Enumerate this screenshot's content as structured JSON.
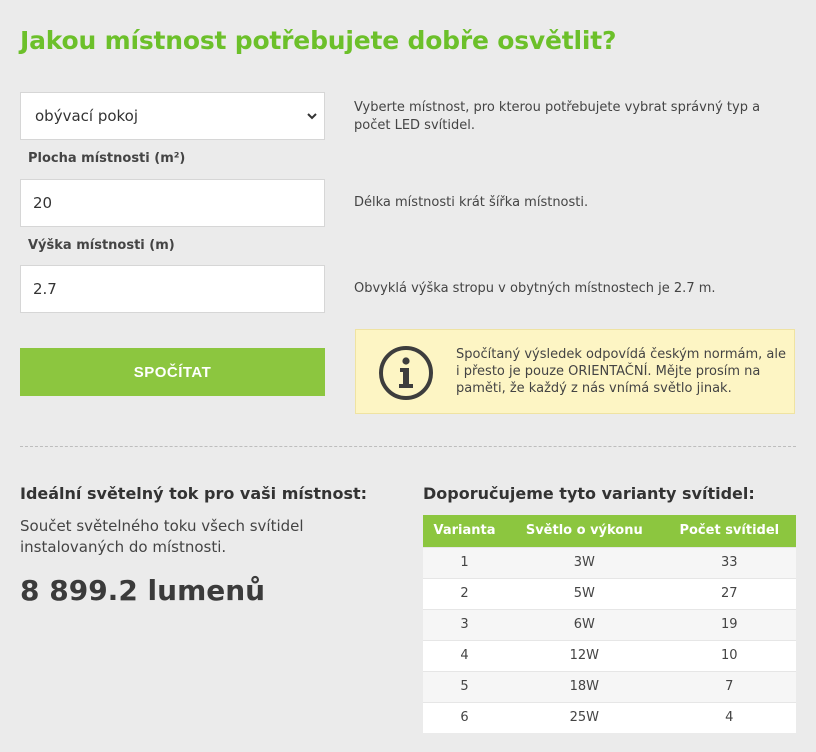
{
  "title": "Jakou místnost potřebujete dobře osvětlit?",
  "room_select": {
    "value": "obývací pokoj",
    "help": "Vyberte místnost, pro kterou potřebujete vybrat správný typ a počet LED svítidel."
  },
  "area": {
    "label": "Plocha místnosti (m²)",
    "value": "20",
    "help": "Délka místnosti krát šířka místnosti."
  },
  "height": {
    "label": "Výška místnosti (m)",
    "value": "2.7",
    "help": "Obvyklá výška stropu v obytných místnostech je 2.7 m."
  },
  "calculate_button": "SPOČÍTAT",
  "notice": {
    "icon": "info-icon",
    "text": "Spočítaný výsledek odpovídá českým normám, ale i přesto je pouze ORIENTAČNÍ. Mějte prosím na paměti, že každý z nás vnímá světlo jinak."
  },
  "result": {
    "heading": "Ideální světelný tok pro vaši místnost:",
    "description": "Součet světelného toku všech svítidel instalovaných do místnosti.",
    "value": "8 899.2 lumenů"
  },
  "recommendations": {
    "heading": "Doporučujeme tyto varianty svítidel:",
    "columns": [
      "Varianta",
      "Světlo o výkonu",
      "Počet svítidel"
    ],
    "rows": [
      [
        "1",
        "3W",
        "33"
      ],
      [
        "2",
        "5W",
        "27"
      ],
      [
        "3",
        "6W",
        "19"
      ],
      [
        "4",
        "12W",
        "10"
      ],
      [
        "5",
        "18W",
        "7"
      ],
      [
        "6",
        "25W",
        "4"
      ]
    ]
  },
  "colors": {
    "accent_green": "#8cc63f",
    "title_green": "#6cc02a",
    "notice_bg": "#fdf5c4"
  }
}
